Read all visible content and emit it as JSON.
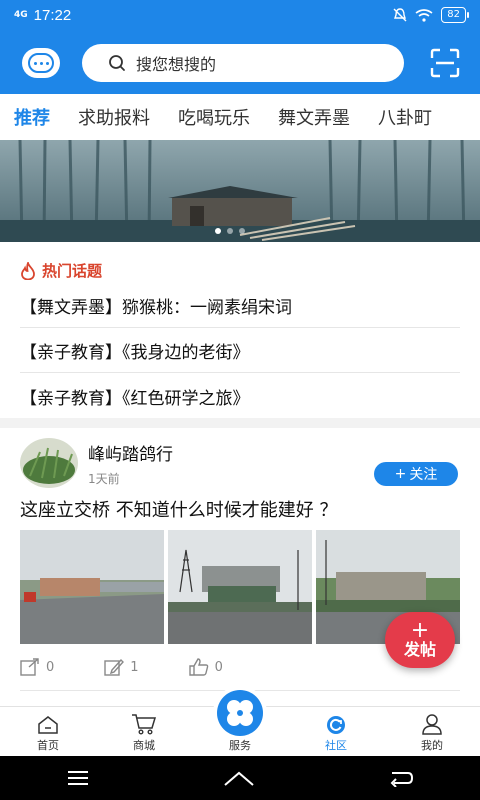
{
  "status_bar": {
    "network": "4G",
    "time": "17:22",
    "battery": "82"
  },
  "header": {
    "search_placeholder": "搜您想搜的"
  },
  "tabs": [
    {
      "label": "推荐",
      "active": true
    },
    {
      "label": "求助报料"
    },
    {
      "label": "吃喝玩乐"
    },
    {
      "label": "舞文弄墨"
    },
    {
      "label": "八卦町"
    }
  ],
  "banner": {
    "slides": 3,
    "current": 1
  },
  "hot_topics": {
    "title": "热门话题",
    "items": [
      "【舞文弄墨】猕猴桃：一阙素绢宋词",
      "【亲子教育】《我身边的老街》",
      "【亲子教育】《红色研学之旅》"
    ]
  },
  "post": {
    "author": "峰屿踏鸽行",
    "time": "1天前",
    "follow_label": "关注",
    "text": "这座立交桥 不知道什么时候才能建好 ？",
    "shares": "0",
    "comments": "1",
    "likes": "0"
  },
  "fab": {
    "label": "发帖"
  },
  "bottom_nav": [
    {
      "label": "首页",
      "icon": "home-icon"
    },
    {
      "label": "商城",
      "icon": "cart-icon"
    },
    {
      "label": "服务",
      "icon": "service-icon"
    },
    {
      "label": "社区",
      "icon": "community-icon",
      "active": true
    },
    {
      "label": "我的",
      "icon": "profile-icon"
    }
  ],
  "colors": {
    "brand": "#1e86e8",
    "hot": "#d9452e",
    "fab": "#e43b4a"
  }
}
